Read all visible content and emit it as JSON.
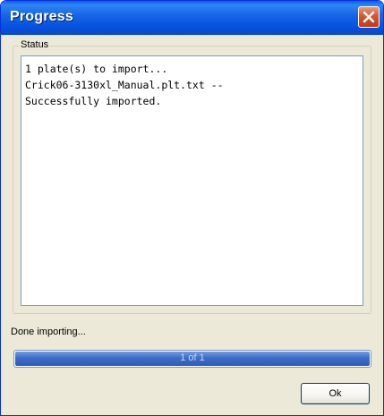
{
  "window": {
    "title": "Progress"
  },
  "status_group": {
    "legend": "Status",
    "lines": [
      "1 plate(s) to import...",
      "Crick06-3130xl_Manual.plt.txt --",
      "Successfully imported."
    ]
  },
  "status_message": "Done importing...",
  "progress": {
    "label": "1 of 1",
    "fraction": 1.0
  },
  "buttons": {
    "ok_label": "Ok"
  },
  "icons": {
    "close": "close-icon"
  },
  "colors": {
    "titlebar": "#0653df",
    "close_button": "#d8552f",
    "progress_fill": "#3d6cc7",
    "dialog_background": "#ece9d8"
  }
}
